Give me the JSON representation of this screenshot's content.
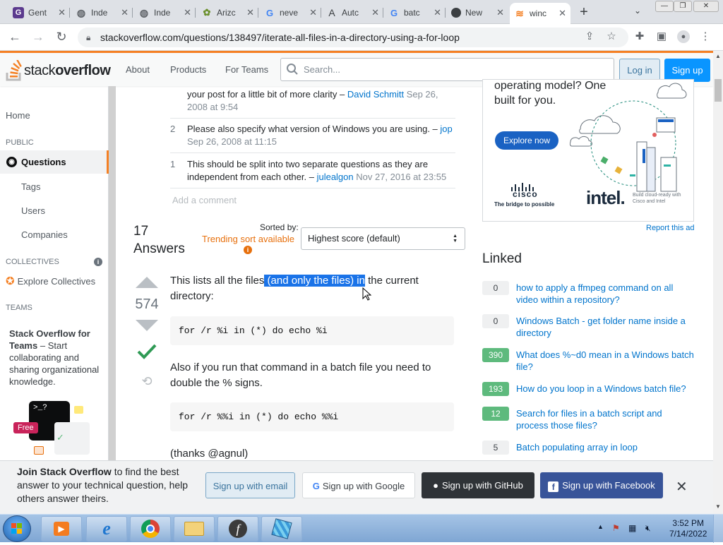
{
  "tabs": [
    {
      "title": "Gent",
      "icon": "gentoo-icon"
    },
    {
      "title": "Inde",
      "icon": "globe-icon"
    },
    {
      "title": "Inde",
      "icon": "globe-icon"
    },
    {
      "title": "Arizc",
      "icon": "plant-icon"
    },
    {
      "title": "neve",
      "icon": "google-icon"
    },
    {
      "title": "Autc",
      "icon": "a-icon"
    },
    {
      "title": "batc",
      "icon": "google-icon"
    },
    {
      "title": "New",
      "icon": "chrome-icon"
    },
    {
      "title": "winc",
      "icon": "stackoverflow-icon"
    }
  ],
  "url": "stackoverflow.com/questions/138497/iterate-all-files-in-a-directory-using-a-for-loop",
  "header": {
    "logo_light": "stack",
    "logo_bold": "overflow",
    "nav": [
      "About",
      "Products",
      "For Teams"
    ],
    "search_placeholder": "Search...",
    "login": "Log in",
    "signup": "Sign up"
  },
  "leftnav": {
    "home": "Home",
    "public": "PUBLIC",
    "questions": "Questions",
    "tags": "Tags",
    "users": "Users",
    "companies": "Companies",
    "collectives": "COLLECTIVES",
    "explore": "Explore Collectives",
    "teams": "TEAMS",
    "teams_title": "Stack Overflow for Teams",
    "teams_desc": " – Start collaborating and sharing organizational knowledge.",
    "free": "Free"
  },
  "comments": [
    {
      "num": "",
      "pre": "your post for a little bit of more clarity – ",
      "user": "David Schmitt",
      "date": " Sep 26, 2008 at 9:54"
    },
    {
      "num": "2",
      "pre": "Please also specify what version of Windows you are using. – ",
      "user": "jop",
      "date": " Sep 26, 2008 at 11:15"
    },
    {
      "num": "1",
      "pre": "This should be split into two separate questions as they are independent from each other. – ",
      "user": "julealgon",
      "date": " Nov 27, 2016 at 23:55"
    }
  ],
  "add_comment": "Add a comment",
  "answers": {
    "count": "17",
    "label": "Answers",
    "sorted_by": "Sorted by:",
    "trending": "Trending sort available",
    "sort_value": "Highest score (default)"
  },
  "answer": {
    "score": "574",
    "p1_a": "This lists all the files",
    "p1_sel": " (and only the files) in",
    "p1_b": " the current directory:",
    "code1": "for /r %i in (*) do echo %i",
    "p2": "Also if you run that command in a batch file you need to double the % signs.",
    "code2": "for /r %%i in (*) do echo %%i",
    "p3": "(thanks @agnul)"
  },
  "ad": {
    "headline": "operating model? One built for you.",
    "cta": "Explore now",
    "cisco": "cisco",
    "cisco_tag": "The bridge to possible",
    "intel": "intel.",
    "intel_tag": "Build cloud-ready with Cisco and Intel",
    "report": "Report this ad"
  },
  "linked": {
    "title": "Linked",
    "items": [
      {
        "votes": "0",
        "accepted": false,
        "text": "how to apply a ffmpeg command on all video within a repository?"
      },
      {
        "votes": "0",
        "accepted": false,
        "text": "Windows Batch - get folder name inside a directory"
      },
      {
        "votes": "390",
        "accepted": true,
        "text": "What does %~d0 mean in a Windows batch file?"
      },
      {
        "votes": "193",
        "accepted": true,
        "text": "How do you loop in a Windows batch file?"
      },
      {
        "votes": "12",
        "accepted": true,
        "text": "Search for files in a batch script and process those files?"
      },
      {
        "votes": "5",
        "accepted": false,
        "text": "Batch populating array in loop"
      }
    ]
  },
  "banner": {
    "bold": "Join Stack Overflow",
    "rest": " to find the best answer to your technical question, help others answer theirs.",
    "email": "Sign up with email",
    "google": "Sign up with Google",
    "github": "Sign up with GitHub",
    "facebook": "Sign up with Facebook"
  },
  "taskbar": {
    "time": "3:52 PM",
    "date": "7/14/2022"
  },
  "colors": {
    "so_orange": "#f48024",
    "link_blue": "#0074cc",
    "accept_green": "#5eba7d",
    "selection_blue": "#1a73e8"
  }
}
